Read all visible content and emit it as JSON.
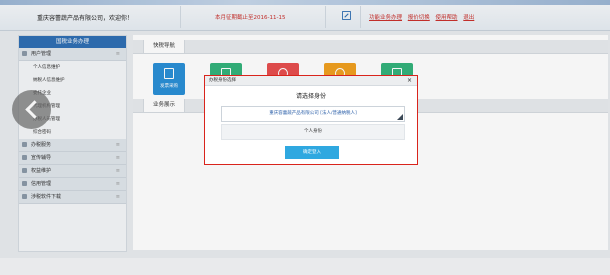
{
  "header": {
    "welcome": "重庆容蕾蔬产品有限公司，欢迎你！",
    "deadline": "本月征期截止至2016-11-15",
    "links": [
      "功能业务办理",
      "报价切换",
      "使用帮助",
      "退出"
    ]
  },
  "sidebar": {
    "title": "国税业务办理",
    "groups": [
      {
        "label": "用户管理",
        "items": [
          "个人信息维护",
          "纳税人信息维护",
          "委托企业",
          "代理机构管理",
          "办税人员管理",
          "综合密码"
        ]
      },
      {
        "label": "办税服务"
      },
      {
        "label": "宣传辅导"
      },
      {
        "label": "权益维护"
      },
      {
        "label": "信用管理"
      },
      {
        "label": "涉税软件下载"
      }
    ]
  },
  "content": {
    "quick_nav_title": "快税导航",
    "quick_tiles": [
      {
        "label": "发票采购",
        "color": "#2a8fd6"
      },
      {
        "label": "",
        "color": "#34b27b"
      },
      {
        "label": "",
        "color": "#e64f4f"
      },
      {
        "label": "",
        "color": "#f0a020"
      },
      {
        "label": "",
        "color": "#34b27b"
      }
    ],
    "business_title": "业务展示"
  },
  "modal": {
    "header": "办税身份选择",
    "close": "×",
    "title": "请选择身份",
    "selected_identity": "重庆容蕾蔬产品有限公司 [法人/普通纳税人]",
    "personal_identity": "个人身份",
    "confirm_label": "确定登入"
  }
}
